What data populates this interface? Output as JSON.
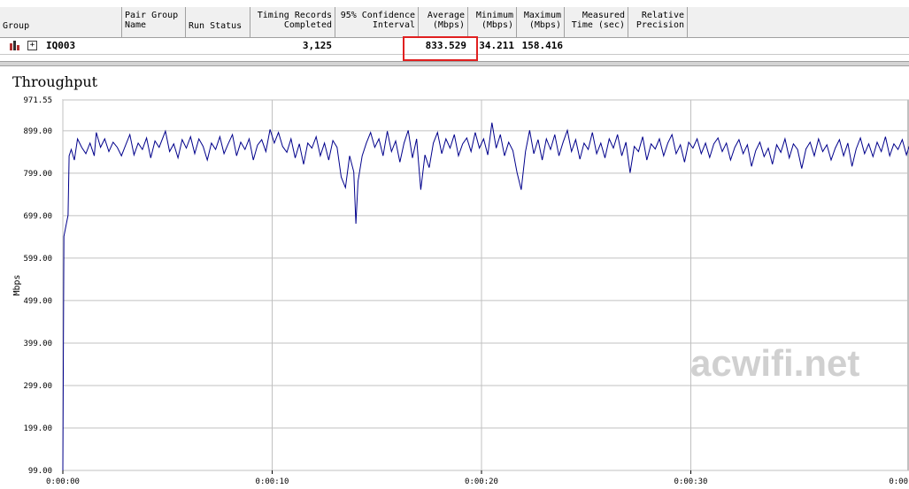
{
  "table": {
    "headers": [
      {
        "key": "group",
        "label": "Group"
      },
      {
        "key": "pair_group_name",
        "label": "Pair Group\nName"
      },
      {
        "key": "run_status",
        "label": "Run Status"
      },
      {
        "key": "timing_records",
        "label": "Timing Records\nCompleted"
      },
      {
        "key": "confidence",
        "label": "95% Confidence\nInterval"
      },
      {
        "key": "average",
        "label": "Average\n(Mbps)"
      },
      {
        "key": "minimum",
        "label": "Minimum\n(Mbps)"
      },
      {
        "key": "maximum",
        "label": "Maximum\n(Mbps)"
      },
      {
        "key": "measured_time",
        "label": "Measured\nTime (sec)"
      },
      {
        "key": "relative_precision",
        "label": "Relative\nPrecision"
      }
    ],
    "row": {
      "group": "IQ003",
      "expand": "+",
      "timing_records": "3,125",
      "average": "833.529",
      "minimum": "34.211",
      "maximum": "158.416"
    }
  },
  "chart_data": {
    "type": "line",
    "title": "Throughput",
    "ylabel": "Mbps",
    "xlabel": "",
    "y_ticks": [
      "99.00",
      "199.00",
      "299.00",
      "399.00",
      "499.00",
      "599.00",
      "699.00",
      "799.00",
      "899.00",
      "971.55"
    ],
    "x_ticks": [
      "0:00:00",
      "0:00:10",
      "0:00:20",
      "0:00:30"
    ],
    "ylim": [
      99.0,
      971.55
    ],
    "xlim_seconds": [
      0,
      41.5
    ],
    "grid": true,
    "series": [
      {
        "color": "#00008b",
        "points": [
          [
            0.0,
            99
          ],
          [
            0.05,
            650
          ],
          [
            0.15,
            675
          ],
          [
            0.25,
            700
          ],
          [
            0.3,
            840
          ],
          [
            0.4,
            855
          ],
          [
            0.55,
            830
          ],
          [
            0.7,
            880
          ],
          [
            0.9,
            860
          ],
          [
            1.1,
            845
          ],
          [
            1.3,
            870
          ],
          [
            1.5,
            840
          ],
          [
            1.6,
            895
          ],
          [
            1.8,
            860
          ],
          [
            2.0,
            880
          ],
          [
            2.2,
            850
          ],
          [
            2.4,
            872
          ],
          [
            2.6,
            860
          ],
          [
            2.8,
            840
          ],
          [
            3.0,
            865
          ],
          [
            3.2,
            890
          ],
          [
            3.4,
            842
          ],
          [
            3.6,
            870
          ],
          [
            3.8,
            855
          ],
          [
            4.0,
            882
          ],
          [
            4.2,
            835
          ],
          [
            4.4,
            875
          ],
          [
            4.6,
            860
          ],
          [
            4.9,
            898
          ],
          [
            5.1,
            850
          ],
          [
            5.3,
            868
          ],
          [
            5.5,
            835
          ],
          [
            5.7,
            878
          ],
          [
            5.9,
            858
          ],
          [
            6.1,
            885
          ],
          [
            6.3,
            845
          ],
          [
            6.5,
            880
          ],
          [
            6.7,
            862
          ],
          [
            6.9,
            830
          ],
          [
            7.1,
            870
          ],
          [
            7.3,
            855
          ],
          [
            7.5,
            885
          ],
          [
            7.7,
            845
          ],
          [
            7.9,
            868
          ],
          [
            8.1,
            890
          ],
          [
            8.3,
            840
          ],
          [
            8.5,
            872
          ],
          [
            8.7,
            855
          ],
          [
            8.9,
            880
          ],
          [
            9.1,
            830
          ],
          [
            9.3,
            865
          ],
          [
            9.5,
            878
          ],
          [
            9.7,
            850
          ],
          [
            9.9,
            902
          ],
          [
            10.1,
            870
          ],
          [
            10.3,
            895
          ],
          [
            10.5,
            862
          ],
          [
            10.7,
            848
          ],
          [
            10.9,
            880
          ],
          [
            11.1,
            835
          ],
          [
            11.3,
            868
          ],
          [
            11.5,
            820
          ],
          [
            11.7,
            870
          ],
          [
            11.9,
            858
          ],
          [
            12.1,
            885
          ],
          [
            12.3,
            840
          ],
          [
            12.5,
            870
          ],
          [
            12.7,
            830
          ],
          [
            12.9,
            876
          ],
          [
            13.1,
            860
          ],
          [
            13.3,
            790
          ],
          [
            13.5,
            765
          ],
          [
            13.7,
            840
          ],
          [
            13.9,
            802
          ],
          [
            14.0,
            680
          ],
          [
            14.1,
            780
          ],
          [
            14.3,
            840
          ],
          [
            14.5,
            870
          ],
          [
            14.7,
            895
          ],
          [
            14.9,
            860
          ],
          [
            15.1,
            880
          ],
          [
            15.3,
            840
          ],
          [
            15.5,
            898
          ],
          [
            15.7,
            850
          ],
          [
            15.9,
            875
          ],
          [
            16.1,
            825
          ],
          [
            16.3,
            870
          ],
          [
            16.5,
            900
          ],
          [
            16.7,
            835
          ],
          [
            16.9,
            880
          ],
          [
            17.1,
            760
          ],
          [
            17.3,
            842
          ],
          [
            17.5,
            812
          ],
          [
            17.7,
            870
          ],
          [
            17.9,
            895
          ],
          [
            18.1,
            845
          ],
          [
            18.3,
            880
          ],
          [
            18.5,
            858
          ],
          [
            18.7,
            890
          ],
          [
            18.9,
            840
          ],
          [
            19.1,
            868
          ],
          [
            19.3,
            882
          ],
          [
            19.5,
            850
          ],
          [
            19.7,
            895
          ],
          [
            19.9,
            858
          ],
          [
            20.1,
            880
          ],
          [
            20.3,
            842
          ],
          [
            20.5,
            918
          ],
          [
            20.7,
            858
          ],
          [
            20.9,
            890
          ],
          [
            21.1,
            840
          ],
          [
            21.3,
            872
          ],
          [
            21.5,
            852
          ],
          [
            21.7,
            800
          ],
          [
            21.9,
            760
          ],
          [
            22.1,
            850
          ],
          [
            22.3,
            900
          ],
          [
            22.5,
            845
          ],
          [
            22.7,
            878
          ],
          [
            22.9,
            830
          ],
          [
            23.1,
            880
          ],
          [
            23.3,
            855
          ],
          [
            23.5,
            890
          ],
          [
            23.7,
            840
          ],
          [
            23.9,
            872
          ],
          [
            24.1,
            900
          ],
          [
            24.3,
            850
          ],
          [
            24.5,
            878
          ],
          [
            24.7,
            832
          ],
          [
            24.9,
            870
          ],
          [
            25.1,
            855
          ],
          [
            25.3,
            895
          ],
          [
            25.5,
            845
          ],
          [
            25.7,
            870
          ],
          [
            25.9,
            835
          ],
          [
            26.1,
            880
          ],
          [
            26.3,
            858
          ],
          [
            26.5,
            890
          ],
          [
            26.7,
            840
          ],
          [
            26.9,
            872
          ],
          [
            27.1,
            800
          ],
          [
            27.3,
            862
          ],
          [
            27.5,
            850
          ],
          [
            27.7,
            885
          ],
          [
            27.9,
            830
          ],
          [
            28.1,
            868
          ],
          [
            28.3,
            856
          ],
          [
            28.5,
            880
          ],
          [
            28.7,
            840
          ],
          [
            28.9,
            870
          ],
          [
            29.1,
            890
          ],
          [
            29.3,
            845
          ],
          [
            29.5,
            866
          ],
          [
            29.7,
            825
          ],
          [
            29.9,
            872
          ],
          [
            30.1,
            858
          ],
          [
            30.3,
            880
          ],
          [
            30.5,
            845
          ],
          [
            30.7,
            870
          ],
          [
            30.9,
            836
          ],
          [
            31.1,
            868
          ],
          [
            31.3,
            882
          ],
          [
            31.5,
            850
          ],
          [
            31.7,
            870
          ],
          [
            31.9,
            830
          ],
          [
            32.1,
            860
          ],
          [
            32.3,
            878
          ],
          [
            32.5,
            845
          ],
          [
            32.7,
            866
          ],
          [
            32.9,
            815
          ],
          [
            33.1,
            852
          ],
          [
            33.3,
            872
          ],
          [
            33.5,
            838
          ],
          [
            33.7,
            858
          ],
          [
            33.9,
            820
          ],
          [
            34.1,
            866
          ],
          [
            34.3,
            848
          ],
          [
            34.5,
            880
          ],
          [
            34.7,
            835
          ],
          [
            34.9,
            868
          ],
          [
            35.1,
            855
          ],
          [
            35.3,
            810
          ],
          [
            35.5,
            856
          ],
          [
            35.7,
            872
          ],
          [
            35.9,
            840
          ],
          [
            36.1,
            880
          ],
          [
            36.3,
            850
          ],
          [
            36.5,
            866
          ],
          [
            36.7,
            830
          ],
          [
            36.9,
            858
          ],
          [
            37.1,
            878
          ],
          [
            37.3,
            840
          ],
          [
            37.5,
            870
          ],
          [
            37.7,
            815
          ],
          [
            37.9,
            856
          ],
          [
            38.1,
            882
          ],
          [
            38.3,
            845
          ],
          [
            38.5,
            868
          ],
          [
            38.7,
            838
          ],
          [
            38.9,
            872
          ],
          [
            39.1,
            850
          ],
          [
            39.3,
            885
          ],
          [
            39.5,
            840
          ],
          [
            39.7,
            868
          ],
          [
            39.9,
            855
          ],
          [
            40.1,
            878
          ],
          [
            40.3,
            842
          ],
          [
            40.5,
            872
          ],
          [
            40.7,
            850
          ],
          [
            40.9,
            868
          ],
          [
            41.0,
            740
          ],
          [
            41.1,
            780
          ],
          [
            41.2,
            720
          ],
          [
            41.35,
            745
          ],
          [
            41.5,
            760
          ]
        ]
      }
    ]
  },
  "watermark": "acwifi.net",
  "colors": {
    "line": "#00008b",
    "highlight": "#e02020",
    "grid": "#c0c0c0"
  }
}
